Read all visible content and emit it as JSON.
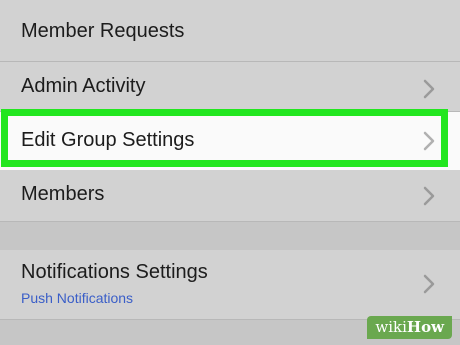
{
  "settings_list": {
    "items": [
      {
        "label": "Member Requests"
      },
      {
        "label": "Admin Activity"
      },
      {
        "label": "Edit Group Settings"
      },
      {
        "label": "Members"
      },
      {
        "label": "Notifications Settings",
        "sublabel": "Push Notifications"
      }
    ],
    "highlighted_item": "Edit Group Settings",
    "highlight_color": "#22e61f",
    "sublabel_color": "#3a5ec8",
    "chevron_icon": "chevron-right-icon"
  },
  "watermark": {
    "prefix": "wiki",
    "suffix": "How",
    "color": "#6aa84f"
  }
}
